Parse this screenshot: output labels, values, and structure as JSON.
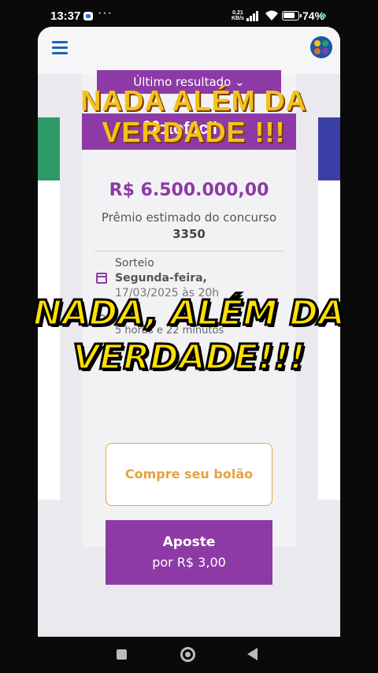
{
  "status_bar": {
    "time": "13:37",
    "dots": "···",
    "speed_value": "0,21",
    "speed_unit": "KB/s",
    "battery_pct": "74"
  },
  "app": {
    "result_selector": "Último resultado ⌄",
    "logo_text": "lotofácil",
    "prize_value": "R$ 6.500.000,00",
    "prize_description": "Prêmio estimado do concurso",
    "contest_number": "3350",
    "draw_label": "Sorteio",
    "draw_date": "Segunda-feira,",
    "draw_date_detail": "17/03/2025 às 20h",
    "countdown": "5 horas e 22 minutos",
    "buy_pool_label": "Compre seu bolão",
    "bet_label": "Aposte",
    "bet_price": "por R$ 3,00"
  },
  "overlays": {
    "top_line1": "NADA  ALÉM DA",
    "top_line2": "VERDADE !!!",
    "middle_line1": "NADA, ALÉM DA",
    "middle_line2": "VERDADE!!!"
  },
  "colors": {
    "lotofacil_purple": "#8d3aa6",
    "pool_orange": "#e6a23c",
    "overlay_yellow": "#ffe100"
  }
}
